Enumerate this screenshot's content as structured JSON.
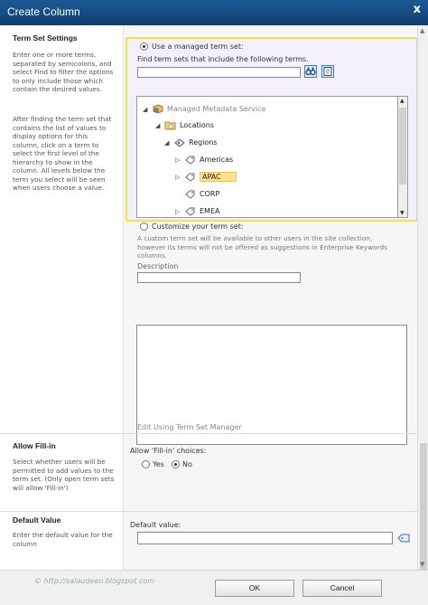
{
  "window": {
    "title": "Create Column",
    "close_symbol": "x"
  },
  "term_set_settings": {
    "title": "Term Set Settings",
    "desc1": "Enter one or more terms, separated by semicolons, and select Find to filter the options to only include those which contain the desired values.",
    "desc2": "After finding the term set that contains the list of values to display options for this column, click on a term to select the first level of the hierarchy to show in the column. All levels below the term you select will be seen when users choose a value.",
    "use_managed_label": "Use a managed term set:",
    "find_label": "Find term sets that include the following terms.",
    "find_value": "",
    "tree": [
      {
        "label": "Managed Metadata Service",
        "toggle": "◢",
        "icon": "metadata-service-icon"
      },
      {
        "label": "Locations",
        "toggle": "◢",
        "icon": "termgroup-folder-icon"
      },
      {
        "label": "Regions",
        "toggle": "◢",
        "icon": "termset-icon"
      },
      {
        "label": "Americas",
        "toggle": "▷",
        "icon": "term-tag-icon"
      },
      {
        "label": "APAC",
        "toggle": "▷",
        "icon": "term-tag-icon",
        "selected": true
      },
      {
        "label": "CORP",
        "toggle": "",
        "icon": "term-tag-icon"
      },
      {
        "label": "EMEA",
        "toggle": "▷",
        "icon": "term-tag-icon"
      }
    ],
    "customize_label": "Customize your term set:",
    "customize_desc": "A custom term set will be available to other users in the site collection, however its terms will not be offered as suggestions in Enterprise Keywords columns.",
    "description_label": "Description",
    "description_value": "",
    "edit_link": "Edit Using Term Set Manager"
  },
  "allow_fill_in": {
    "title": "Allow Fill-in",
    "desc": "Select whether users will be permitted to add values to the term set. (Only open term sets will allow 'Fill-in')",
    "choices_label": "Allow 'Fill-in' choices:",
    "yes_label": "Yes",
    "no_label": "No",
    "selected": "No"
  },
  "default_value": {
    "title": "Default Value",
    "desc": "Enter the default value for the column",
    "label": "Default value:",
    "value": ""
  },
  "footer": {
    "watermark": "© http://salaudeen.blogspot.com",
    "ok_label": "OK",
    "cancel_label": "Cancel"
  },
  "colors": {
    "title_bar": "#1c5a94",
    "highlight_border": "#f2e24b",
    "selected_term": "#ffe28a"
  }
}
